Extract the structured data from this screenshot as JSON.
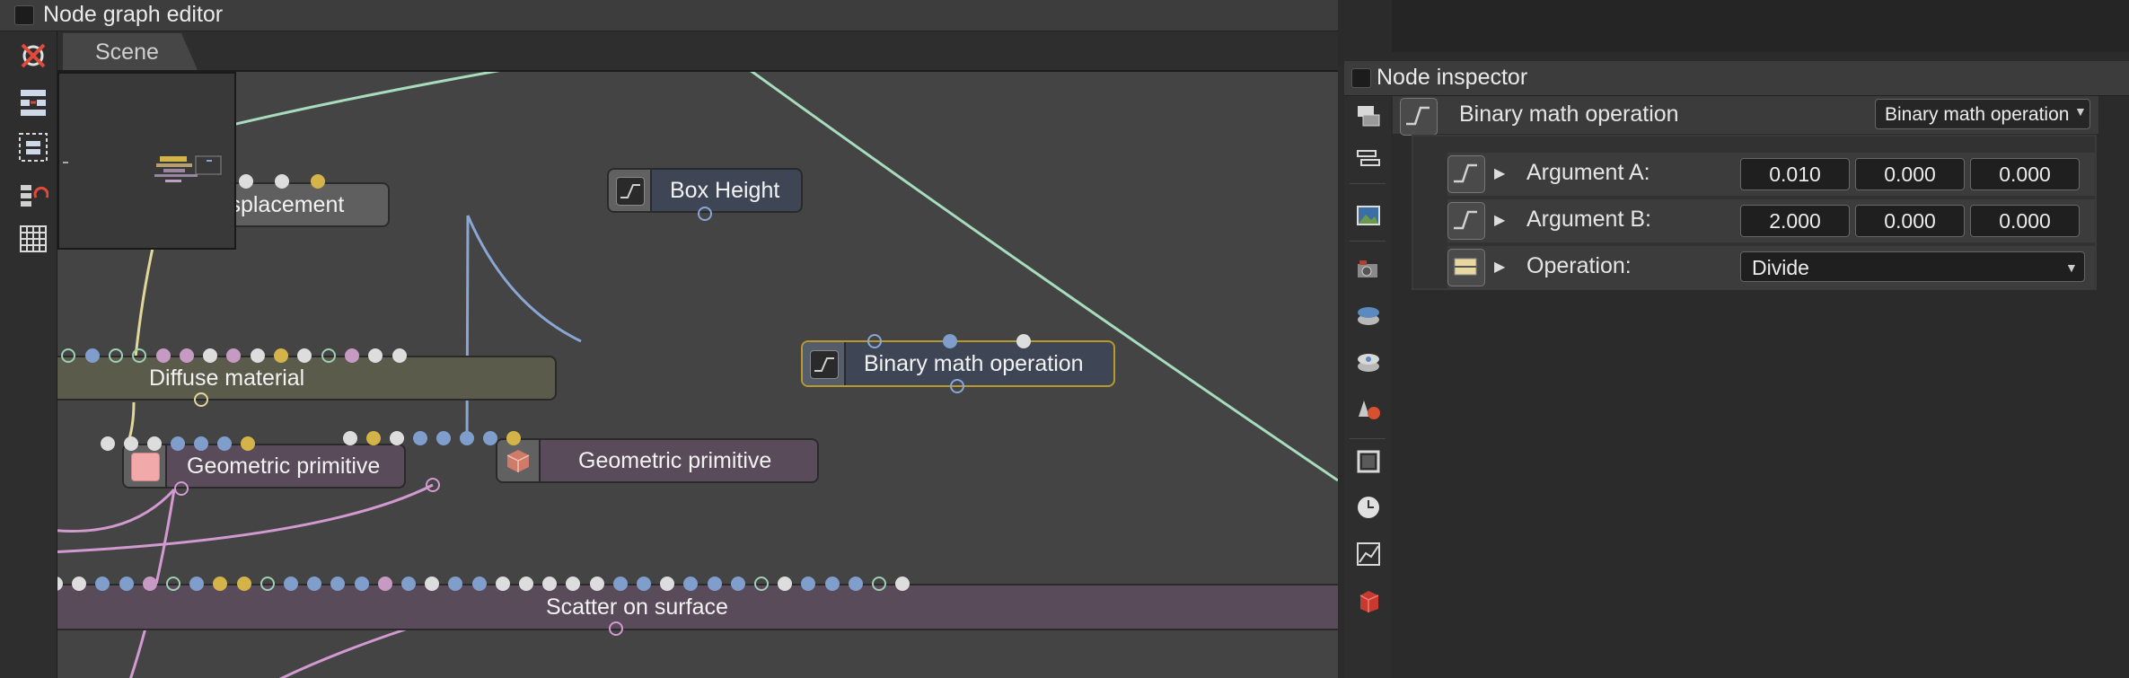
{
  "node_graph_editor": {
    "title": "Node graph editor",
    "tabs": [
      {
        "label": "Scene"
      }
    ],
    "toolbar": [
      "unstash-nodes-icon",
      "rearrange-icon",
      "fit-view-icon",
      "macro-icon",
      "table-icon"
    ]
  },
  "nodes": {
    "displacement": {
      "label": "displacement"
    },
    "box_height": {
      "label": "Box Height"
    },
    "binary_math": {
      "label": "Binary math operation"
    },
    "diffuse_material": {
      "label": "Diffuse material"
    },
    "geometric_primitive_1": {
      "label": "Geometric primitive"
    },
    "geometric_primitive_2": {
      "label": "Geometric primitive"
    },
    "scatter": {
      "label": "Scatter on surface"
    }
  },
  "node_inspector": {
    "title": "Node inspector",
    "header": {
      "node_name": "Binary math operation",
      "type_dropdown": "Binary math operation"
    },
    "rows": [
      {
        "label": "Argument A:",
        "values": [
          "0.010",
          "0.000",
          "0.000"
        ]
      },
      {
        "label": "Argument B:",
        "values": [
          "2.000",
          "0.000",
          "0.000"
        ]
      },
      {
        "label": "Operation:",
        "dropdown": "Divide"
      }
    ],
    "toolbar": [
      "layers-icon",
      "stack-icon",
      "image-icon",
      "camera-icon",
      "render-target-icon",
      "film-icon",
      "materials-icon",
      "crop-icon",
      "clock-icon",
      "chart-icon",
      "cube-icon"
    ]
  },
  "colors": {
    "pin_white": "#dddddd",
    "pin_blue": "#7f9ecb",
    "pin_pink": "#c79ac4",
    "pin_yellow": "#d4b449",
    "pin_green": "#9fd0b3",
    "wire_green": "#a8dcbf",
    "wire_blue": "#8aa6d4",
    "wire_pink": "#d39ad2",
    "wire_yellow": "#e2d79a",
    "selected_outline": "#b89a2c"
  }
}
